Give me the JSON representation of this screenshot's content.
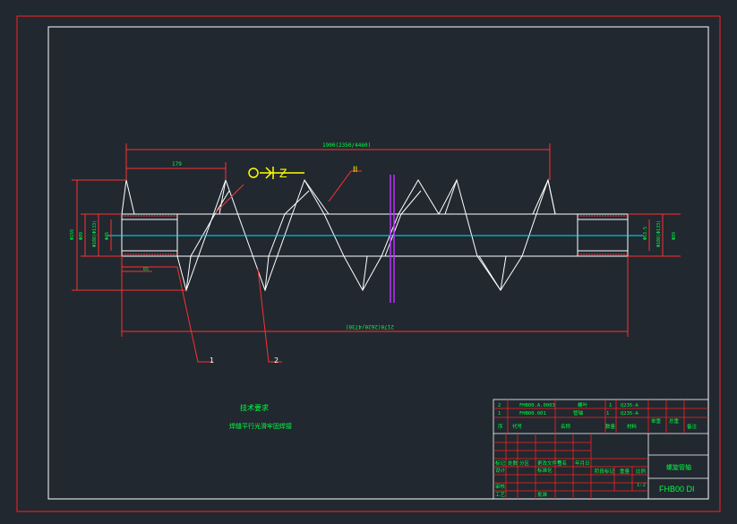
{
  "drawing": {
    "top_dimension": "1900(2350/4460)",
    "pitch_dimension": "179",
    "bottom_dimension": "2170(2620/4730)",
    "left_dims": [
      "Φ159",
      "Φ89",
      "Φ108(Φ133)",
      "Φ45",
      "Φ63.5"
    ],
    "right_dims": [
      "Φ89",
      "Φ108(Φ133)",
      "Φ63.5"
    ],
    "left_small_dim": "65",
    "callout_1": "1",
    "callout_2": "2",
    "roughness_label": "II",
    "symbol_text": "Z"
  },
  "notes": {
    "title": "技术要求",
    "line": "焊缝平行光滑牢固焊接"
  },
  "title_block": {
    "row1": [
      "2",
      "FHB00.A.0003",
      "螺叶",
      "1",
      "Q235-A"
    ],
    "row2": [
      "1",
      "FHB00.001",
      "管轴",
      "1",
      "Q235-A"
    ],
    "header": [
      "序",
      "代号",
      "名称",
      "数量",
      "材料",
      "单重",
      "总重",
      "备注"
    ],
    "drawing_name": "螺旋管轴",
    "drawing_no": "FHB00 DI",
    "scale": "1:2",
    "labels": [
      "标记",
      "处数",
      "分区",
      "更改文件号",
      "签名",
      "年月日",
      "设计",
      "标准化",
      "审核",
      "工艺",
      "批准",
      "阶段标记",
      "重量",
      "比例"
    ]
  },
  "colors": {
    "background": "#212830",
    "frame": "#ff2020",
    "geometry": "#ffffff",
    "dimension": "#ff3030",
    "text": "#00ff40",
    "center": "#00e5ff",
    "cut": "#c030ff",
    "symbol": "#ffff00"
  }
}
